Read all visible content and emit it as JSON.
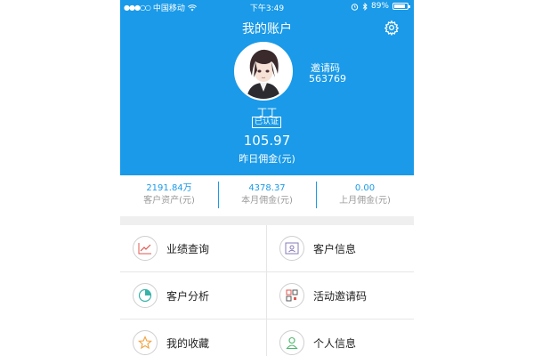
{
  "status_bar": {
    "carrier": "中国移动",
    "time": "下午3:49",
    "battery": "89%",
    "battery_level": 0.89
  },
  "header": {
    "title": "我的账户",
    "invite_label": "邀请码",
    "invite_code": "563769",
    "user_name": "丁丁",
    "verified": "已认证",
    "commission_value": "105.97",
    "commission_label": "昨日佣金(元)"
  },
  "stats": [
    {
      "value": "2191.84万",
      "label": "客户资产(元)"
    },
    {
      "value": "4378.37",
      "label": "本月佣金(元)"
    },
    {
      "value": "0.00",
      "label": "上月佣金(元)"
    }
  ],
  "menu": [
    {
      "label": "业绩查询",
      "icon": "trend-chart-icon"
    },
    {
      "label": "客户信息",
      "icon": "id-card-icon"
    },
    {
      "label": "客户分析",
      "icon": "pie-chart-icon"
    },
    {
      "label": "活动邀请码",
      "icon": "qr-code-icon"
    },
    {
      "label": "我的收藏",
      "icon": "star-icon"
    },
    {
      "label": "个人信息",
      "icon": "person-icon"
    }
  ],
  "colors": {
    "accent": "#1a9ae8",
    "icon_red": "#e0574f",
    "icon_teal": "#36b3a8",
    "icon_orange": "#f0a23c",
    "icon_green": "#4cb56b"
  }
}
